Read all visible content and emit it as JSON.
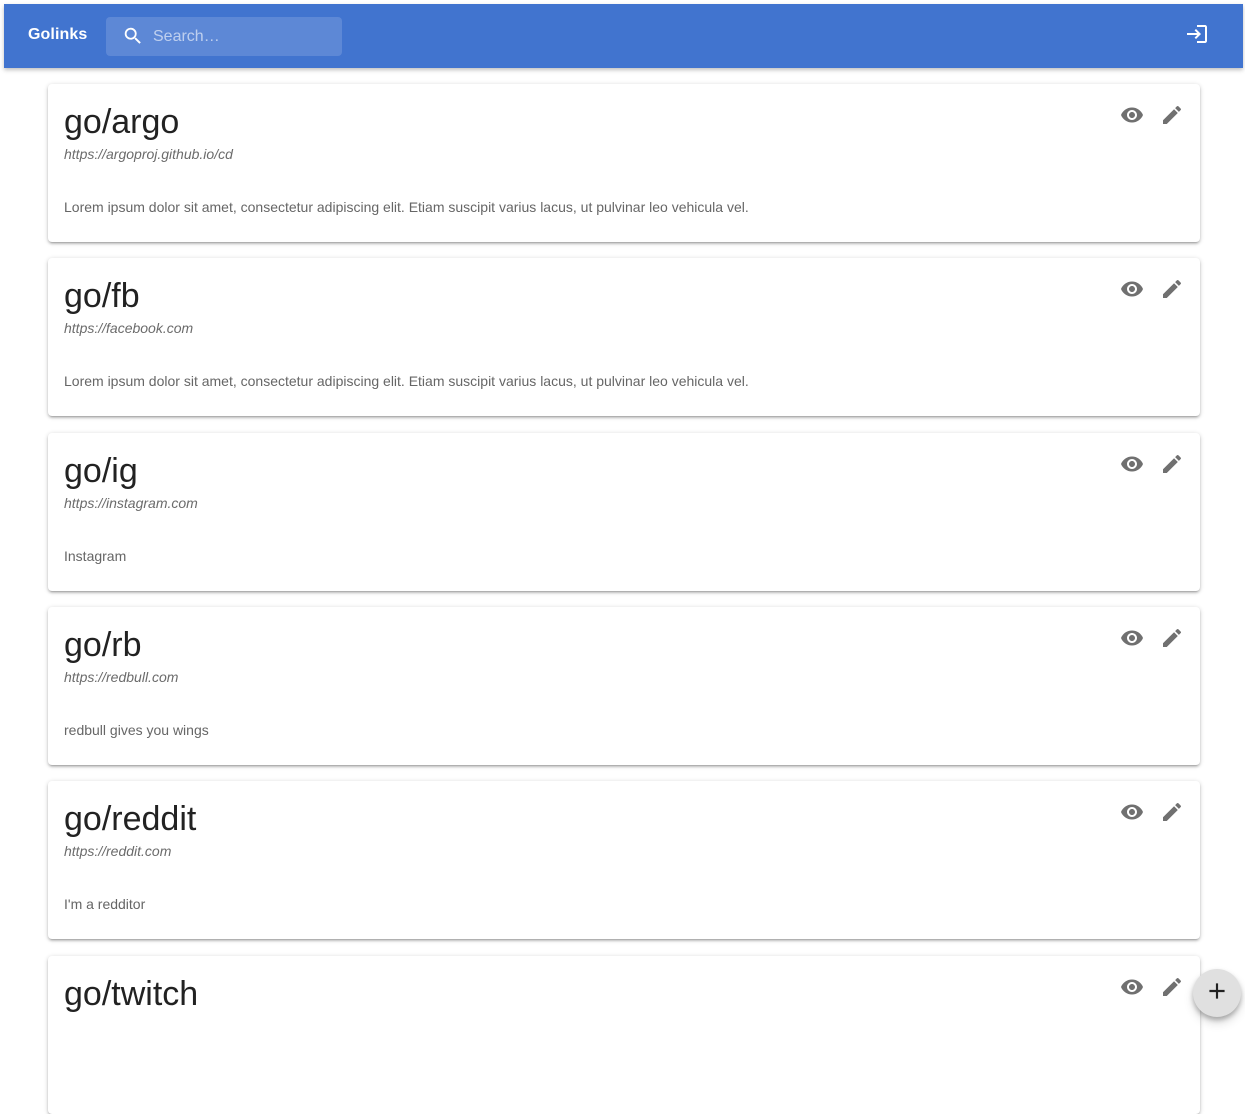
{
  "appbar": {
    "title": "Golinks",
    "search_placeholder": "Search…",
    "search_value": "",
    "color": "#4174cf",
    "search_icon": "search-icon",
    "login_icon": "login-icon"
  },
  "links": [
    {
      "title": "go/argo",
      "url": "https://argoproj.github.io/cd",
      "description": "Lorem ipsum dolor sit amet, consectetur adipiscing elit. Etiam suscipit varius lacus, ut pulvinar leo vehicula vel."
    },
    {
      "title": "go/fb",
      "url": "https://facebook.com",
      "description": "Lorem ipsum dolor sit amet, consectetur adipiscing elit. Etiam suscipit varius lacus, ut pulvinar leo vehicula vel."
    },
    {
      "title": "go/ig",
      "url": "https://instagram.com",
      "description": "Instagram"
    },
    {
      "title": "go/rb",
      "url": "https://redbull.com",
      "description": "redbull gives you wings"
    },
    {
      "title": "go/reddit",
      "url": "https://reddit.com",
      "description": "I'm a redditor"
    },
    {
      "title": "go/twitch",
      "url": "",
      "description": ""
    }
  ],
  "card_actions": {
    "view_icon": "eye-icon",
    "edit_icon": "pencil-icon"
  },
  "fab": {
    "icon": "plus-icon"
  }
}
